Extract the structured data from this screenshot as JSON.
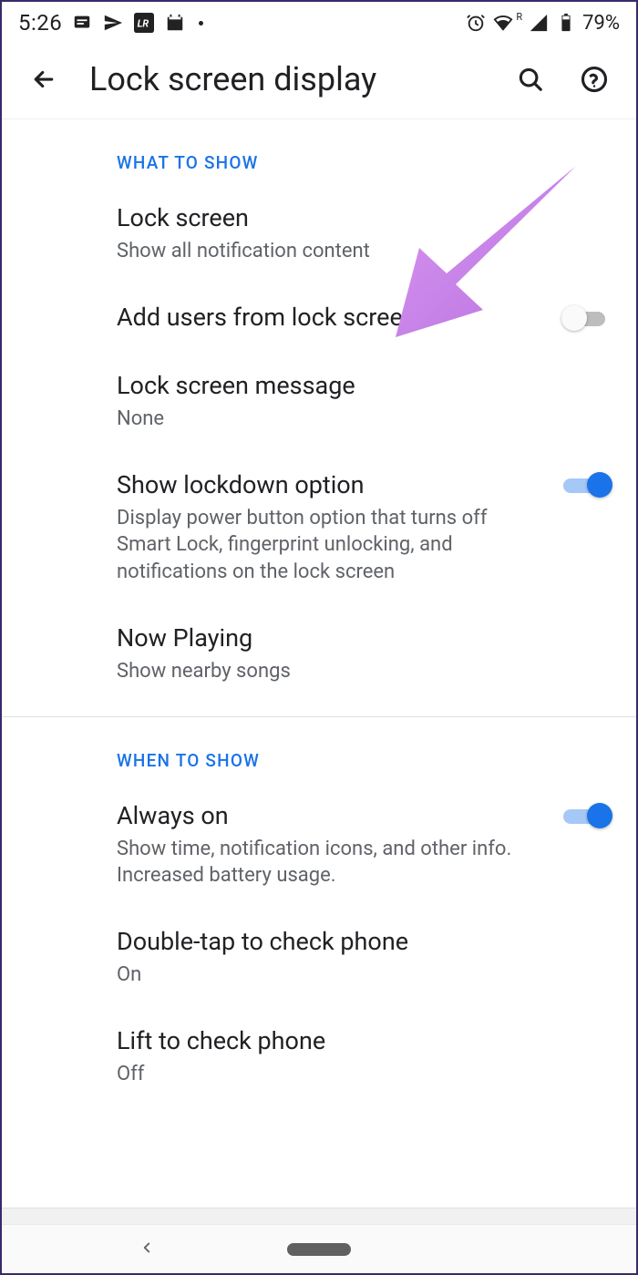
{
  "status": {
    "time": "5:26",
    "battery": "79%",
    "roaming": "R"
  },
  "header": {
    "title": "Lock screen display"
  },
  "sections": {
    "s1": {
      "header": "WHAT TO SHOW",
      "lock_screen": {
        "title": "Lock screen",
        "sub": "Show all notification content"
      },
      "add_users": {
        "title": "Add users from lock screen"
      },
      "lock_msg": {
        "title": "Lock screen message",
        "sub": "None"
      },
      "lockdown": {
        "title": "Show lockdown option",
        "sub": "Display power button option that turns off Smart Lock, fingerprint unlocking, and notifications on the lock screen"
      },
      "now_playing": {
        "title": "Now Playing",
        "sub": "Show nearby songs"
      }
    },
    "s2": {
      "header": "WHEN TO SHOW",
      "always_on": {
        "title": "Always on",
        "sub": "Show time, notification icons, and other info. Increased battery usage."
      },
      "double_tap": {
        "title": "Double-tap to check phone",
        "sub": "On"
      },
      "lift": {
        "title": "Lift to check phone",
        "sub": "Off"
      }
    }
  }
}
